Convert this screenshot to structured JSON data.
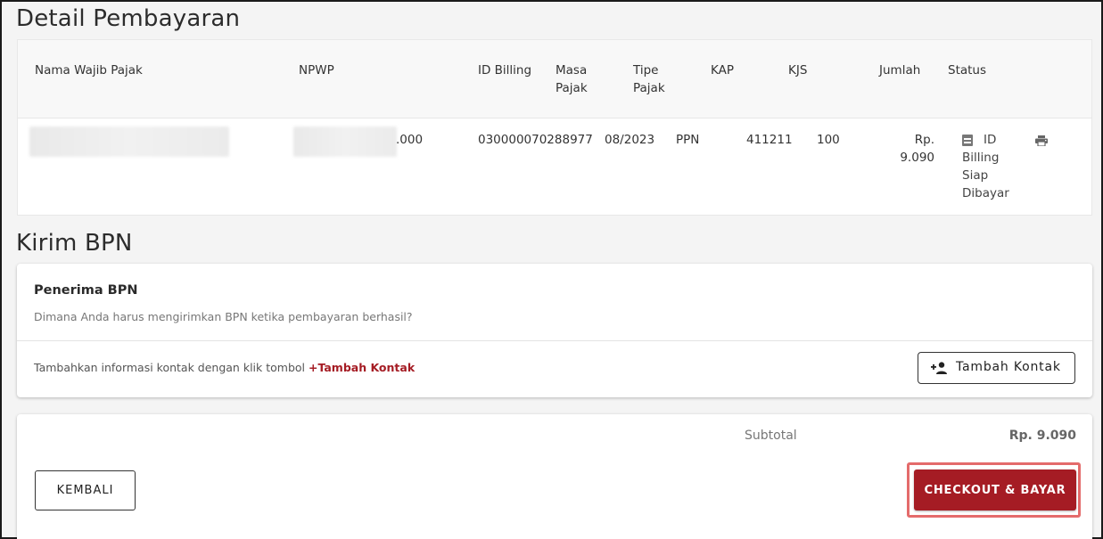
{
  "detail": {
    "title": "Detail Pembayaran",
    "columns": {
      "nama": "Nama Wajib Pajak",
      "npwp": "NPWP",
      "id_billing": "ID Billing",
      "masa_pajak_1": "Masa",
      "masa_pajak_2": "Pajak",
      "tipe_pajak_1": "Tipe",
      "tipe_pajak_2": "Pajak",
      "kap": "KAP",
      "kjs": "KJS",
      "jumlah": "Jumlah",
      "status": "Status"
    },
    "row": {
      "npwp_suffix": ".000",
      "id_billing": "030000070288977",
      "masa_pajak": "08/2023",
      "tipe_pajak": "PPN",
      "kap": "411211",
      "kjs": "100",
      "jumlah_1": "Rp.",
      "jumlah_2": "9.090",
      "status": "ID Billing Siap Dibayar",
      "status_icon": "document-icon",
      "action_icon": "print-icon"
    }
  },
  "bpn": {
    "title": "Kirim BPN",
    "heading": "Penerima BPN",
    "subtitle": "Dimana Anda harus mengirimkan BPN ketika pembayaran berhasil?",
    "info_text": "Tambahkan informasi kontak dengan klik tombol ",
    "info_link": "+Tambah Kontak",
    "add_contact_label": "Tambah Kontak",
    "add_contact_icon": "person-add-icon"
  },
  "summary": {
    "subtotal_label": "Subtotal",
    "subtotal_value": "Rp. 9.090",
    "back_label": "KEMBALI",
    "checkout_label": "CHECKOUT & BAYAR"
  },
  "colors": {
    "accent": "#a51c24",
    "highlight": "#e46b6b"
  }
}
